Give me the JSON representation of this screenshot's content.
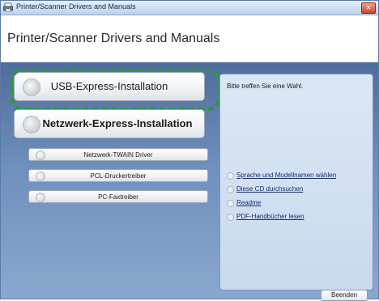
{
  "window": {
    "title": "Printer/Scanner Drivers and Manuals",
    "close_glyph": "×"
  },
  "header": {
    "title": "Printer/Scanner Drivers and Manuals"
  },
  "main_buttons": [
    {
      "label": "USB-Express-Installation",
      "icon": "disc-icon"
    },
    {
      "label": "Netzwerk-Express-Installation",
      "icon": "disc-icon"
    }
  ],
  "driver_buttons": [
    {
      "label": "Netzwerk-TWAIN Driver",
      "icon": "disc-icon"
    },
    {
      "label": "PCL-Druckertreiber",
      "icon": "disc-icon"
    },
    {
      "label": "PC-Faxtreiber",
      "icon": "disc-icon"
    }
  ],
  "info_panel": {
    "prompt": "Bitte treffen Sie eine Wahl.",
    "links": [
      "Sprache und Modellnamen wählen",
      "Diese CD durchsuchen",
      "Readme",
      "PDF-Handbücher lesen"
    ]
  },
  "footer": {
    "close_label": "Beenden"
  },
  "colors": {
    "highlight": "#2a9a3a",
    "background_top": "#4f6d9c",
    "background_bottom": "#8aa7cf"
  }
}
